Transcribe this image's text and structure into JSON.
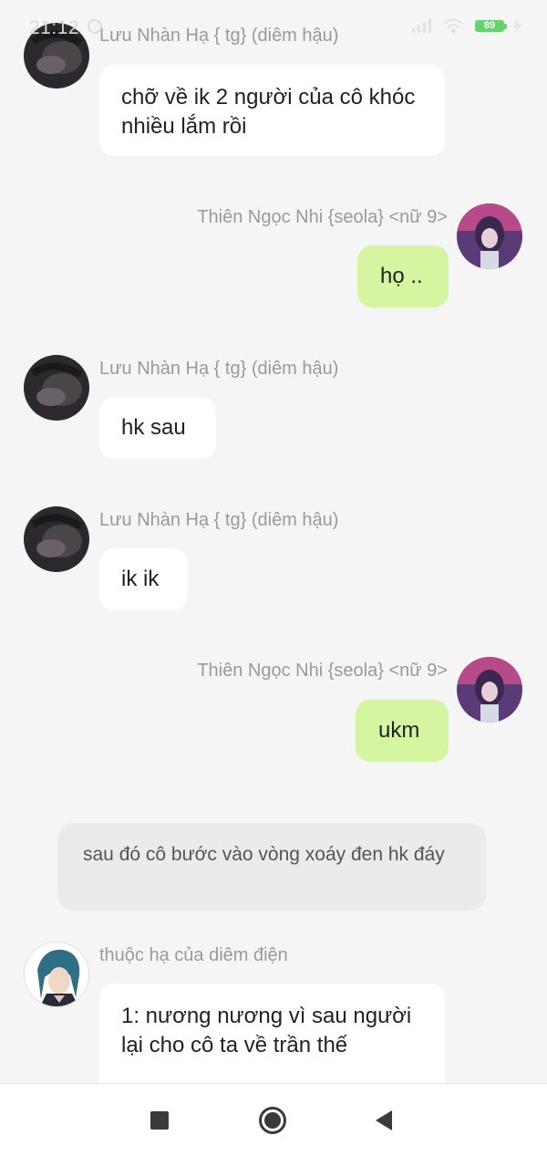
{
  "status_bar": {
    "time": "21:12",
    "battery": "89"
  },
  "messages": [
    {
      "sender": "Lưu Nhàn Hạ { tg} (diêm hậu)",
      "text": "chỡ về ik 2 người của cô khóc nhiều lắm rồi",
      "side": "left"
    },
    {
      "sender": "Thiên Ngọc Nhi {seola} <nữ 9>",
      "text": "họ ..",
      "side": "right"
    },
    {
      "sender": "Lưu Nhàn Hạ { tg} (diêm hậu)",
      "text": "hk sau",
      "side": "left"
    },
    {
      "sender": "Lưu Nhàn Hạ { tg} (diêm hậu)",
      "text": "ik ik",
      "side": "left"
    },
    {
      "sender": "Thiên Ngọc Nhi {seola} <nữ 9>",
      "text": "ukm",
      "side": "right"
    },
    {
      "sender": "thuộc hạ của diêm điện",
      "text": "1: nương nương vì sau người lại cho cô ta về trần thế",
      "side": "left"
    }
  ],
  "narration": {
    "text": "sau đó cô bước vào vòng xoáy đen hk đáy"
  },
  "colors": {
    "background": "#f5f5f5",
    "bubble_left": "#ffffff",
    "bubble_right": "#d6f5a0",
    "narration": "#ebebeb",
    "sender_text": "#9a9a9a",
    "battery": "#65d46e"
  },
  "nav_bar": {
    "icons": [
      "recent-apps-square-icon",
      "home-circle-icon",
      "back-triangle-icon"
    ]
  }
}
